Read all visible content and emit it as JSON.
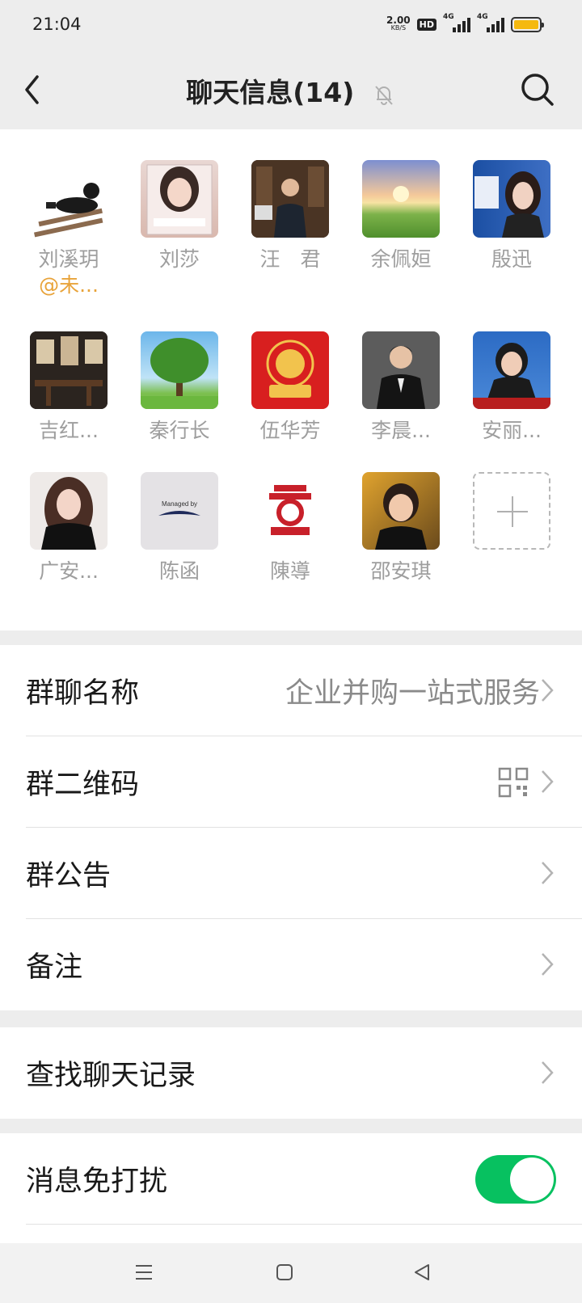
{
  "status_bar": {
    "time": "21:04",
    "speed_value": "2.00",
    "speed_unit": "KB/S",
    "hd_label": "HD",
    "signal1_label": "4G",
    "signal2_label": "4G",
    "battery_color": "#f5b90f"
  },
  "header": {
    "title": "聊天信息(14)",
    "back_icon": "chevron-left-icon",
    "mute_icon": "bell-off-icon",
    "search_icon": "search-icon"
  },
  "members": [
    {
      "name": "刘溪玥",
      "sub": "@未..."
    },
    {
      "name": "刘莎"
    },
    {
      "name": "汪　君"
    },
    {
      "name": "余佩姮"
    },
    {
      "name": "殷迅"
    },
    {
      "name": "吉红..."
    },
    {
      "name": "秦行长"
    },
    {
      "name": "伍华芳"
    },
    {
      "name": "李晨..."
    },
    {
      "name": "安丽..."
    },
    {
      "name": "广安..."
    },
    {
      "name": "陈函"
    },
    {
      "name": "陳導"
    },
    {
      "name": "邵安琪"
    }
  ],
  "avatar_text": {
    "chenhan": "Managed by"
  },
  "settings": {
    "group_name_label": "群聊名称",
    "group_name_value": "企业并购一站式服务",
    "qrcode_label": "群二维码",
    "notice_label": "群公告",
    "remark_label": "备注",
    "search_history_label": "查找聊天记录",
    "mute_label": "消息免打扰",
    "mute_enabled": true,
    "toggle_color": "#07c160"
  }
}
